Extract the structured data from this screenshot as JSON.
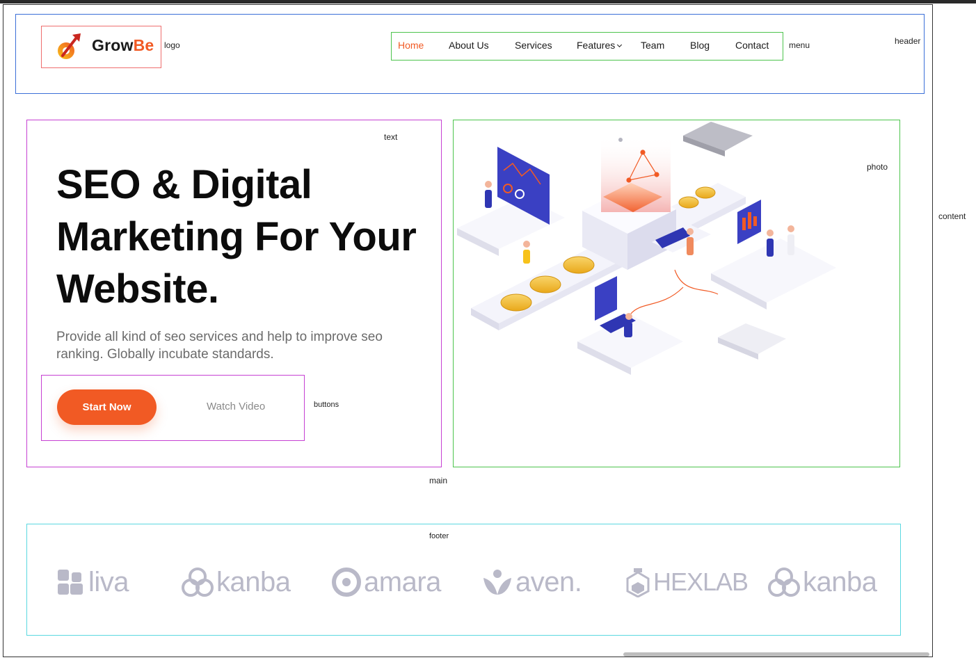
{
  "annotations": {
    "logo": "logo",
    "menu": "menu",
    "header": "header",
    "text": "text",
    "photo": "photo",
    "content": "content",
    "buttons": "buttons",
    "main": "main",
    "footer": "footer"
  },
  "logo": {
    "part1": "Grow",
    "part2": "Be"
  },
  "menu": {
    "items": [
      "Home",
      "About Us",
      "Services",
      "Features",
      "Team",
      "Blog",
      "Contact"
    ],
    "active": "Home"
  },
  "hero": {
    "title": "SEO & Digital Marketing For Your Website.",
    "subtitle": "Provide all kind of seo services and help to improve seo ranking. Globally incubate standards.",
    "primary_button": "Start Now",
    "secondary_button": "Watch Video"
  },
  "brands": [
    "liva",
    "kanba",
    "amara",
    "aven.",
    "HEXLAB",
    "kanba"
  ],
  "colors": {
    "accent": "#f15a24",
    "header_border": "#3b6fd8",
    "menu_border": "#4cc44c",
    "text_border": "#c640d3",
    "footer_border": "#5ad8e0",
    "brand_gray": "#b9b9c8"
  }
}
